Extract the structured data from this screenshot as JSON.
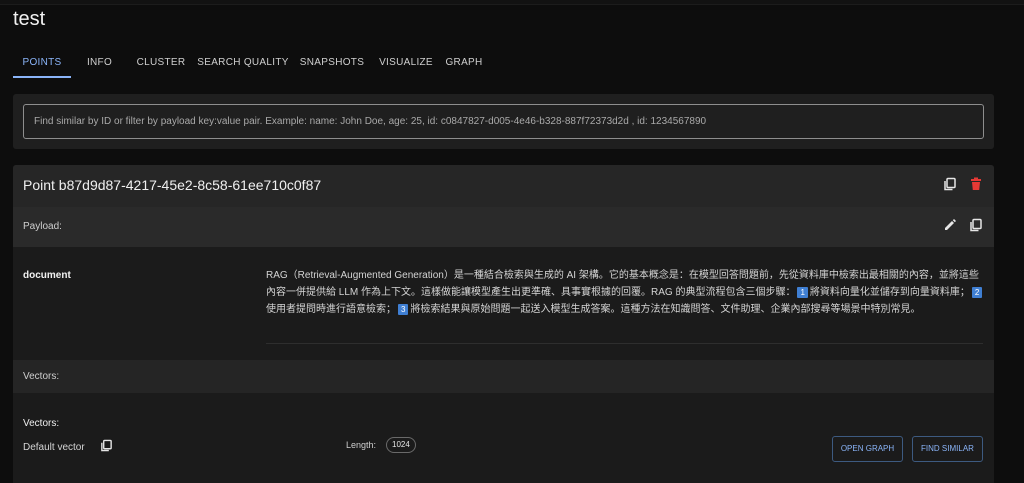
{
  "collection": {
    "title": "test"
  },
  "tabs": [
    {
      "label": "POINTS",
      "active": true
    },
    {
      "label": "INFO",
      "active": false
    },
    {
      "label": "CLUSTER",
      "active": false
    },
    {
      "label": "SEARCH QUALITY",
      "active": false
    },
    {
      "label": "SNAPSHOTS",
      "active": false
    },
    {
      "label": "VISUALIZE",
      "active": false
    },
    {
      "label": "GRAPH",
      "active": false
    }
  ],
  "search": {
    "placeholder": "Find similar by ID or filter by payload key:value pair. Example: name: John Doe, age: 25, id: c0847827-d005-4e46-b328-887f72373d2d , id: 1234567890",
    "value": ""
  },
  "point": {
    "title": "Point b87d9d87-4217-45e2-8c58-61ee710c0f87",
    "icons": {
      "copy": "copy-icon",
      "delete": "delete-icon",
      "edit": "edit-icon"
    },
    "payload_label": "Payload:",
    "payload": {
      "key": "document",
      "text_part1": "RAG（Retrieval-Augmented Generation）是一種結合檢索與生成的 AI 架構。它的基本概念是：在模型回答問題前，先從資料庫中檢索出最相關的內容，並將這些內容一併提供給 LLM 作為上下文。這樣做能讓模型產生出更準確、具事實根據的回覆。RAG 的典型流程包含三個步驟：",
      "step1_num": "1",
      "step1_text": "將資料向量化並儲存到向量資料庫；",
      "step2_num": "2",
      "step2_text": "使用者提問時進行語意檢索；",
      "step3_num": "3",
      "step3_text": "將檢索結果與原始問題一起送入模型生成答案。這種方法在知識問答、文件助理、企業內部搜尋等場景中特別常見。"
    },
    "vectors_header": "Vectors:",
    "vectors_label": "Vectors:",
    "vector": {
      "name": "Default vector",
      "length_label": "Length:",
      "length": "1024",
      "open_graph_label": "OPEN GRAPH",
      "find_similar_label": "FIND SIMILAR"
    }
  },
  "colors": {
    "accent": "#8ab4f8",
    "danger": "#e53935",
    "step_badge": "#3f7fd3"
  }
}
